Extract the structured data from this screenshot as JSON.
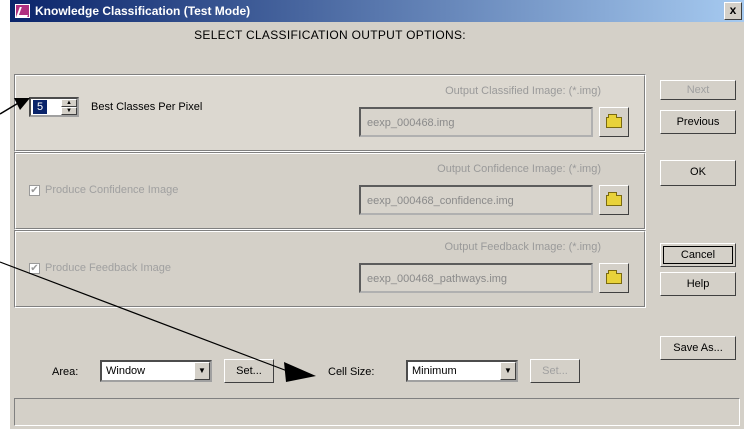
{
  "window": {
    "title": "Knowledge Classification (Test Mode)",
    "close_label": "x",
    "heading": "SELECT CLASSIFICATION OUTPUT OPTIONS:"
  },
  "classified": {
    "spinner_value": "5",
    "spinner_label": "Best Classes Per Pixel",
    "output_label": "Output Classified Image: (*.img)",
    "output_value": "eexp_000468.img"
  },
  "confidence": {
    "checkbox_label": "Produce Confidence Image",
    "checked": true,
    "output_label": "Output Confidence Image: (*.img)",
    "output_value": "eexp_000468_confidence.img"
  },
  "feedback": {
    "checkbox_label": "Produce Feedback Image",
    "checked": true,
    "output_label": "Output Feedback Image: (*.img)",
    "output_value": "eexp_000468_pathways.img"
  },
  "area": {
    "label": "Area:",
    "value": "Window",
    "set_label": "Set..."
  },
  "cell_size": {
    "label": "Cell Size:",
    "value": "Minimum",
    "set_label": "Set..."
  },
  "buttons": {
    "next": "Next",
    "previous": "Previous",
    "ok": "OK",
    "cancel": "Cancel",
    "help": "Help",
    "save_as": "Save As..."
  },
  "icons": {
    "folder": "folder-icon",
    "app": "app-icon"
  }
}
